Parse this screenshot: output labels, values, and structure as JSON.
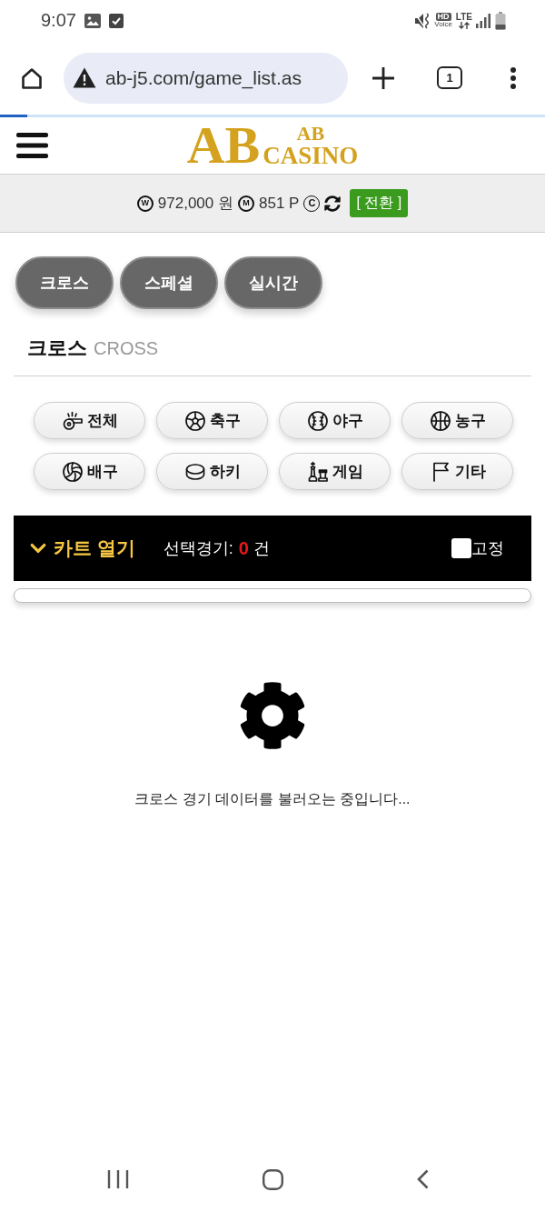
{
  "status_bar": {
    "time": "9:07",
    "hd": "HD",
    "voice": "Voice",
    "network": "LTE"
  },
  "browser": {
    "url": "ab-j5.com/game_list.as",
    "tab_count": "1",
    "load_progress": {
      "level": 0.05
    }
  },
  "header": {
    "logo": {
      "mark": "AB",
      "top": "AB",
      "bottom": "CASINO"
    }
  },
  "balance_bar": {
    "cash_symbol": "W",
    "cash": "972,000 원",
    "mileage_symbol": "M",
    "mileage": "851 P",
    "casino_symbol": "C",
    "switch_button": "[ 전환 ]"
  },
  "tabs": [
    {
      "label": "크로스"
    },
    {
      "label": "스페셜"
    },
    {
      "label": "실시간"
    }
  ],
  "section": {
    "title": "크로스",
    "subtitle": "CROSS"
  },
  "sports": [
    {
      "kind": "all",
      "label": "전체"
    },
    {
      "kind": "soccer",
      "label": "축구"
    },
    {
      "kind": "baseball",
      "label": "야구"
    },
    {
      "kind": "basketball",
      "label": "농구"
    },
    {
      "kind": "volleyball",
      "label": "배구"
    },
    {
      "kind": "hockey",
      "label": "하키"
    },
    {
      "kind": "game",
      "label": "게임"
    },
    {
      "kind": "other",
      "label": "기타"
    }
  ],
  "cart": {
    "toggle": "카트 열기",
    "count_label": "선택경기:",
    "count": "0",
    "count_unit": "건",
    "pin_label": "고정",
    "pinned": false
  },
  "loading": {
    "message": "크로스 경기 데이터를 불러오는 중입니다..."
  }
}
